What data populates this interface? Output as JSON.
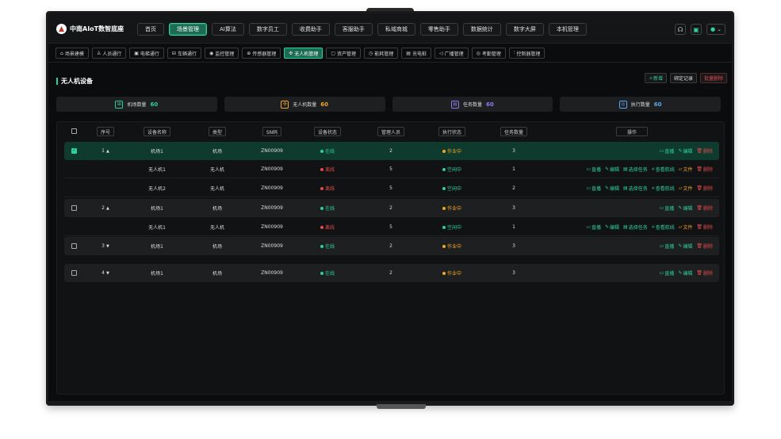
{
  "app": {
    "title": "中南AIoT数智底座"
  },
  "nav": [
    "首页",
    "场景管理",
    "AI算法",
    "数字员工",
    "收费助手",
    "客服助手",
    "私域商城",
    "零售助手",
    "数据统计",
    "数字大屏",
    "本机管理"
  ],
  "nav_active": 1,
  "subnav": [
    {
      "icon": "scene-icon",
      "glyph": "⌂",
      "label": "场景建模"
    },
    {
      "icon": "person-icon",
      "glyph": "♙",
      "label": "人员通行"
    },
    {
      "icon": "elevator-icon",
      "glyph": "▣",
      "label": "电梯通行"
    },
    {
      "icon": "car-icon",
      "glyph": "⊟",
      "label": "车辆通行"
    },
    {
      "icon": "camera-icon",
      "glyph": "◉",
      "label": "监控管理"
    },
    {
      "icon": "sensor-icon",
      "glyph": "⊕",
      "label": "传感器管理"
    },
    {
      "icon": "drone-icon",
      "glyph": "✣",
      "label": "无人机管理"
    },
    {
      "icon": "asset-icon",
      "glyph": "▢",
      "label": "资产管理"
    },
    {
      "icon": "energy-icon",
      "glyph": "◷",
      "label": "能耗管理"
    },
    {
      "icon": "charger-icon",
      "glyph": "▤",
      "label": "充电桩"
    },
    {
      "icon": "broadcast-icon",
      "glyph": "◁",
      "label": "广播管理"
    },
    {
      "icon": "attendance-icon",
      "glyph": "◎",
      "label": "考勤管理"
    },
    {
      "icon": "controller-icon",
      "glyph": "⫶",
      "label": "控制器管理"
    }
  ],
  "subnav_active": 6,
  "page": {
    "title": "无人机设备",
    "add": "新增",
    "bind": "绑定记录",
    "batch_delete": "批量删除"
  },
  "stats": [
    {
      "icon": "hangar-icon",
      "glyph": "⊞",
      "label": "机场数量",
      "value": "60",
      "color": "#2fd19a"
    },
    {
      "icon": "drone-icon",
      "glyph": "✣",
      "label": "无人机数量",
      "value": "60",
      "color": "#f5a623"
    },
    {
      "icon": "task-icon",
      "glyph": "▤",
      "label": "任务数量",
      "value": "60",
      "color": "#8a7cf0"
    },
    {
      "icon": "execute-icon",
      "glyph": "◎",
      "label": "执行数量",
      "value": "60",
      "color": "#5aa8f0"
    }
  ],
  "columns": [
    "序号",
    "设备名称",
    "类型",
    "SN码",
    "设备状态",
    "管理人员",
    "执行状态",
    "任务数量",
    "操作"
  ],
  "ops": {
    "live": "直播",
    "edit": "编辑",
    "delete": "删除",
    "select_task": "选择任务",
    "track": "查看航线",
    "file": "文件"
  },
  "rows": [
    {
      "kind": "group",
      "selected": true,
      "no": "1",
      "arrow": "▲",
      "name": "机场1",
      "type": "机场",
      "sn": "ZN00909",
      "status": "在线",
      "status_cls": "s-on",
      "manager": "2",
      "exec": "作业中",
      "exec_cls": "s-work",
      "tasks": "3"
    },
    {
      "kind": "child",
      "name": "无人机1",
      "type": "无人机",
      "sn": "ZN00909",
      "status": "离线",
      "status_cls": "s-off",
      "manager": "5",
      "exec": "空闲中",
      "exec_cls": "s-idle",
      "tasks": "1"
    },
    {
      "kind": "child",
      "name": "无人机2",
      "type": "无人机",
      "sn": "ZN00909",
      "status": "离线",
      "status_cls": "s-off",
      "manager": "5",
      "exec": "空闲中",
      "exec_cls": "s-idle",
      "tasks": "2"
    },
    {
      "kind": "group",
      "selected": false,
      "no": "2",
      "arrow": "▲",
      "name": "机场1",
      "type": "机场",
      "sn": "ZN00909",
      "status": "在线",
      "status_cls": "s-on",
      "manager": "2",
      "exec": "作业中",
      "exec_cls": "s-work",
      "tasks": "3"
    },
    {
      "kind": "child",
      "name": "无人机1",
      "type": "无人机",
      "sn": "ZN00909",
      "status": "离线",
      "status_cls": "s-off",
      "manager": "5",
      "exec": "空闲中",
      "exec_cls": "s-idle",
      "tasks": "1"
    },
    {
      "kind": "group",
      "selected": false,
      "no": "3",
      "arrow": "▼",
      "name": "机场1",
      "type": "机场",
      "sn": "ZN00909",
      "status": "在线",
      "status_cls": "s-on",
      "manager": "2",
      "exec": "作业中",
      "exec_cls": "s-work",
      "tasks": "3"
    },
    {
      "kind": "group",
      "selected": false,
      "no": "4",
      "arrow": "▼",
      "name": "机场1",
      "type": "机场",
      "sn": "ZN00909",
      "status": "在线",
      "status_cls": "s-on",
      "manager": "2",
      "exec": "作业中",
      "exec_cls": "s-work",
      "tasks": "3"
    }
  ]
}
